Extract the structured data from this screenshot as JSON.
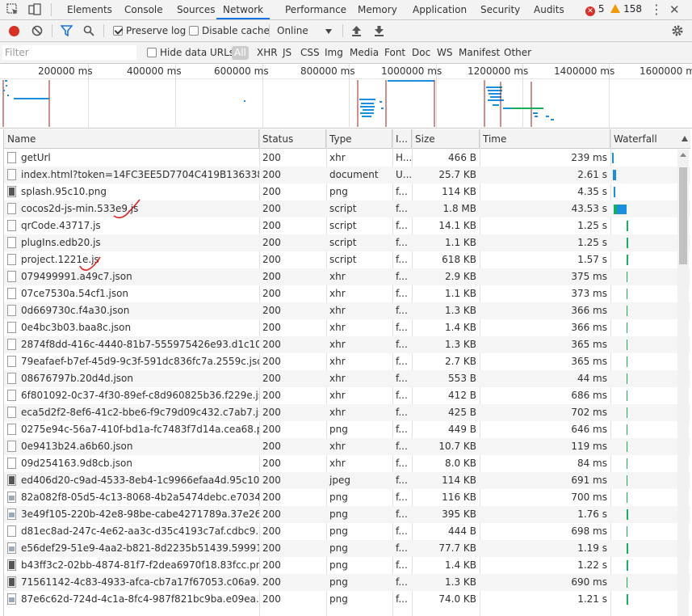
{
  "tabbar": {
    "tabs": [
      "Elements",
      "Console",
      "Sources",
      "Network",
      "Performance",
      "Memory",
      "Application",
      "Security",
      "Audits"
    ],
    "active": "Network",
    "error_count": "5",
    "warning_count": "158"
  },
  "toolbar": {
    "preserve_log": "Preserve log",
    "disable_cache": "Disable cache",
    "throttle": "Online"
  },
  "filterbar": {
    "placeholder": "Filter",
    "hide_data_urls": "Hide data URLs",
    "types": [
      "All",
      "XHR",
      "JS",
      "CSS",
      "Img",
      "Media",
      "Font",
      "Doc",
      "WS",
      "Manifest",
      "Other"
    ]
  },
  "overview": {
    "ticks": [
      "200000 ms",
      "400000 ms",
      "600000 ms",
      "800000 ms",
      "1000000 ms",
      "1200000 ms",
      "1400000 ms",
      "1600000 m"
    ]
  },
  "columns": [
    "Name",
    "Status",
    "Type",
    "I...",
    "Size",
    "Time",
    "Waterfall"
  ],
  "colors": {
    "accent": "#1a73e8",
    "error": "#d93025",
    "warning": "#f29900",
    "wf_blue": "#1a8fe0",
    "wf_green": "#14b05c"
  },
  "requests": [
    {
      "name": "getUrl",
      "status": "200",
      "type": "xhr",
      "initiator": "H...",
      "size": "466 B",
      "time": "239 ms",
      "icon": "file"
    },
    {
      "name": "index.html?token=14FC3EE5D7704C419B136338540...",
      "status": "200",
      "type": "document",
      "initiator": "U...",
      "size": "25.7 KB",
      "time": "2.61 s",
      "icon": "file"
    },
    {
      "name": "splash.95c10.png",
      "status": "200",
      "type": "png",
      "initiator": "f...",
      "size": "114 KB",
      "time": "4.35 s",
      "icon": "dark"
    },
    {
      "name": "cocos2d-js-min.533e9.js",
      "status": "200",
      "type": "script",
      "initiator": "f...",
      "size": "1.8 MB",
      "time": "43.53 s",
      "icon": "file"
    },
    {
      "name": "qrCode.43717.js",
      "status": "200",
      "type": "script",
      "initiator": "f...",
      "size": "14.1 KB",
      "time": "1.25 s",
      "icon": "file"
    },
    {
      "name": "plugIns.edb20.js",
      "status": "200",
      "type": "script",
      "initiator": "f...",
      "size": "1.1 KB",
      "time": "1.25 s",
      "icon": "file"
    },
    {
      "name": "project.1221e.js",
      "status": "200",
      "type": "script",
      "initiator": "f...",
      "size": "618 KB",
      "time": "1.57 s",
      "icon": "file"
    },
    {
      "name": "079499991.a49c7.json",
      "status": "200",
      "type": "xhr",
      "initiator": "f...",
      "size": "2.9 KB",
      "time": "375 ms",
      "icon": "file"
    },
    {
      "name": "07ce7530a.54cf1.json",
      "status": "200",
      "type": "xhr",
      "initiator": "f...",
      "size": "1.1 KB",
      "time": "373 ms",
      "icon": "file"
    },
    {
      "name": "0d669730c.f4a30.json",
      "status": "200",
      "type": "xhr",
      "initiator": "f...",
      "size": "1.3 KB",
      "time": "366 ms",
      "icon": "file"
    },
    {
      "name": "0e4bc3b03.baa8c.json",
      "status": "200",
      "type": "xhr",
      "initiator": "f...",
      "size": "1.4 KB",
      "time": "366 ms",
      "icon": "file"
    },
    {
      "name": "2874f8dd-416c-4440-81b7-555975426e93.d1c10.json",
      "status": "200",
      "type": "xhr",
      "initiator": "f...",
      "size": "1.3 KB",
      "time": "365 ms",
      "icon": "file"
    },
    {
      "name": "79eafaef-b7ef-45d9-9c3f-591dc836fc7a.2559c.json",
      "status": "200",
      "type": "xhr",
      "initiator": "f...",
      "size": "2.7 KB",
      "time": "365 ms",
      "icon": "file"
    },
    {
      "name": "08676797b.20d4d.json",
      "status": "200",
      "type": "xhr",
      "initiator": "f...",
      "size": "553 B",
      "time": "44 ms",
      "icon": "file"
    },
    {
      "name": "6f801092-0c37-4f30-89ef-c8d960825b36.f229e.json",
      "status": "200",
      "type": "xhr",
      "initiator": "f...",
      "size": "412 B",
      "time": "686 ms",
      "icon": "file"
    },
    {
      "name": "eca5d2f2-8ef6-41c2-bbe6-f9c79d09c432.c7ab7.json",
      "status": "200",
      "type": "xhr",
      "initiator": "f...",
      "size": "425 B",
      "time": "702 ms",
      "icon": "file"
    },
    {
      "name": "0275e94c-56a7-410f-bd1a-fc7483f7d14a.cea68.png",
      "status": "200",
      "type": "png",
      "initiator": "f...",
      "size": "449 B",
      "time": "646 ms",
      "icon": "file"
    },
    {
      "name": "0e9413b24.a6b60.json",
      "status": "200",
      "type": "xhr",
      "initiator": "f...",
      "size": "10.7 KB",
      "time": "119 ms",
      "icon": "file"
    },
    {
      "name": "09d254163.9d8cb.json",
      "status": "200",
      "type": "xhr",
      "initiator": "f...",
      "size": "8.0 KB",
      "time": "84 ms",
      "icon": "file"
    },
    {
      "name": "ed406d20-c9ad-4533-8eb4-1c9966efaa4d.95c10.jpg",
      "status": "200",
      "type": "jpeg",
      "initiator": "f...",
      "size": "114 KB",
      "time": "691 ms",
      "icon": "dark"
    },
    {
      "name": "82a082f8-05d5-4c13-8068-4b2a5474debc.e7034.png",
      "status": "200",
      "type": "png",
      "initiator": "f...",
      "size": "116 KB",
      "time": "700 ms",
      "icon": "img"
    },
    {
      "name": "3e49f105-220b-42e8-98be-cabe4271789a.37e26.png",
      "status": "200",
      "type": "png",
      "initiator": "f...",
      "size": "395 KB",
      "time": "1.76 s",
      "icon": "img"
    },
    {
      "name": "d81ec8ad-247c-4e62-aa3c-d35c4193c7af.cdbc9.png",
      "status": "200",
      "type": "png",
      "initiator": "f...",
      "size": "444 B",
      "time": "698 ms",
      "icon": "file"
    },
    {
      "name": "e56def29-51e9-4aa2-b821-8d2235b51439.59991.png",
      "status": "200",
      "type": "png",
      "initiator": "f...",
      "size": "77.7 KB",
      "time": "1.19 s",
      "icon": "img"
    },
    {
      "name": "b43ff3c2-02bb-4874-81f7-f2dea6970f18.83fcc.png",
      "status": "200",
      "type": "png",
      "initiator": "f...",
      "size": "1.4 KB",
      "time": "1.22 s",
      "icon": "dark"
    },
    {
      "name": "71561142-4c83-4933-afca-cb7a17f67053.c06a9.png",
      "status": "200",
      "type": "png",
      "initiator": "f...",
      "size": "1.3 KB",
      "time": "690 ms",
      "icon": "dark"
    },
    {
      "name": "87e6c62d-724d-4c1a-8fc4-987f821bc9ba.e09ea.png",
      "status": "200",
      "type": "png",
      "initiator": "f...",
      "size": "74.0 KB",
      "time": "1.21 s",
      "icon": "img"
    }
  ]
}
